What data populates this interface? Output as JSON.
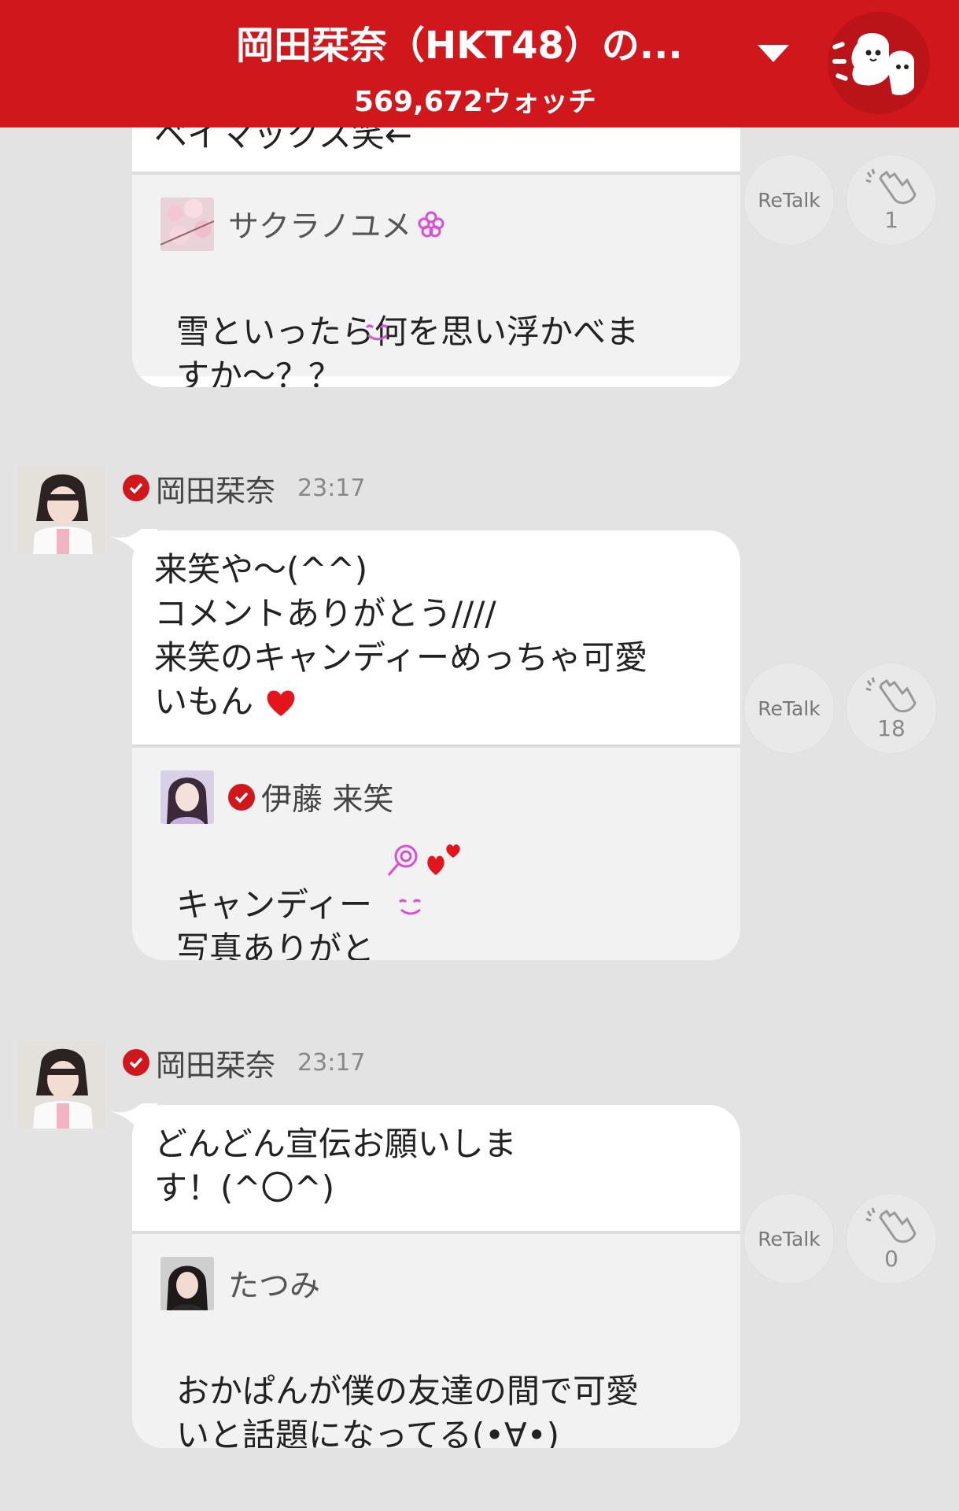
{
  "header": {
    "title": "岡田栞奈（HKT48）の...",
    "watch_count": "569,672ウォッチ",
    "dropdown_icon": "caret-down-icon",
    "mascot_icon": "ghost-mascot-icon"
  },
  "colors": {
    "brand": "#d0181c",
    "background": "#e3e3e3",
    "bubble": "#ffffff",
    "quote_bg": "#f2f2f2"
  },
  "posts": [
    {
      "partial_top_text": "ベイマックス笑←",
      "quote": {
        "name": "サクラノユメ",
        "verified": false,
        "text": "雪といったら何を思い浮かべま\nすか～？？"
      },
      "retalk_label": "ReTalk",
      "clap_count": "1"
    },
    {
      "author": "岡田栞奈",
      "time": "23:17",
      "verified": true,
      "text": "来笑や～(^^)\nコメントありがとう////\n来笑のキャンディーめっちゃ可愛\nいもん",
      "quote": {
        "name": "伊藤 来笑",
        "verified": true,
        "text": "キャンディー\n写真ありがと"
      },
      "retalk_label": "ReTalk",
      "clap_count": "18"
    },
    {
      "author": "岡田栞奈",
      "time": "23:17",
      "verified": true,
      "text": "どんどん宣伝お願いしま\nす！(^〇^)",
      "quote": {
        "name": "たつみ",
        "verified": false,
        "text": "おかぱんが僕の友達の間で可愛\nいと話題になってる(•∀•)"
      },
      "retalk_label": "ReTalk",
      "clap_count": "0"
    }
  ]
}
